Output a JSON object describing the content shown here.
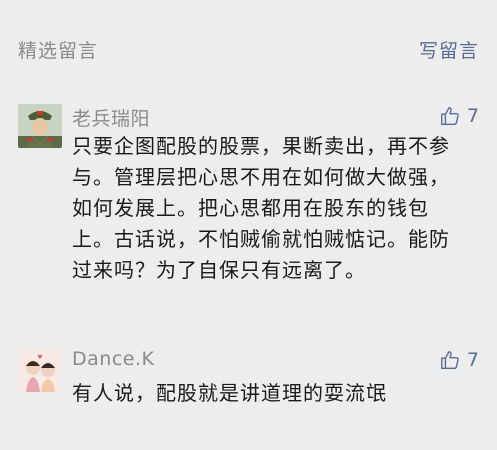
{
  "header": {
    "title": "精选留言",
    "write_comment": "写留言"
  },
  "comments": [
    {
      "nickname": "老兵瑞阳",
      "likes": "7",
      "content": "只要企图配股的股票，果断卖出，再不参与。管理层把心思不用在如何做大做强，如何发展上。把心思都用在股东的钱包上。古话说，不怕贼偷就怕贼惦记。能防过来吗？为了自保只有远离了。"
    },
    {
      "nickname": "Dance.K",
      "likes": "7",
      "content": "有人说，配股就是讲道理的耍流氓"
    }
  ],
  "icons": {
    "like": "thumbs-up-icon"
  },
  "colors": {
    "background": "#ededed",
    "link": "#576b95",
    "muted": "#8a8a8a",
    "text": "#1a1a1a"
  }
}
